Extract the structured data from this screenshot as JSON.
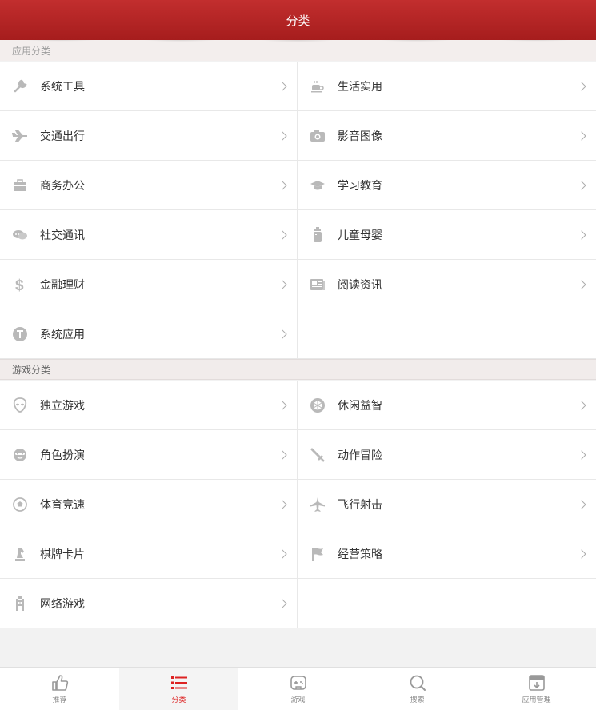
{
  "header": {
    "title": "分类"
  },
  "sections": {
    "apps_title": "应用分类",
    "games_title": "游戏分类"
  },
  "apps": [
    {
      "label": "系统工具",
      "icon": "wrench-icon"
    },
    {
      "label": "生活实用",
      "icon": "coffee-cup-icon"
    },
    {
      "label": "交通出行",
      "icon": "airplane-icon"
    },
    {
      "label": "影音图像",
      "icon": "camera-icon"
    },
    {
      "label": "商务办公",
      "icon": "briefcase-icon"
    },
    {
      "label": "学习教育",
      "icon": "graduation-cap-icon"
    },
    {
      "label": "社交通讯",
      "icon": "chat-bubbles-icon"
    },
    {
      "label": "儿童母婴",
      "icon": "baby-bottle-icon"
    },
    {
      "label": "金融理财",
      "icon": "dollar-icon"
    },
    {
      "label": "阅读资讯",
      "icon": "newspaper-icon"
    },
    {
      "label": "系统应用",
      "icon": "system-badge-icon"
    }
  ],
  "games": [
    {
      "label": "独立游戏",
      "icon": "alien-icon"
    },
    {
      "label": "休闲益智",
      "icon": "puzzle-cube-icon"
    },
    {
      "label": "角色扮演",
      "icon": "mask-icon"
    },
    {
      "label": "动作冒险",
      "icon": "sword-icon"
    },
    {
      "label": "体育竞速",
      "icon": "soccer-ball-icon"
    },
    {
      "label": "飞行射击",
      "icon": "fighter-jet-icon"
    },
    {
      "label": "棋牌卡片",
      "icon": "chess-knight-icon"
    },
    {
      "label": "经营策略",
      "icon": "flag-icon"
    },
    {
      "label": "网络游戏",
      "icon": "castle-tower-icon"
    }
  ],
  "tabbar": [
    {
      "label": "推荐",
      "icon": "thumbs-up-icon",
      "active": false
    },
    {
      "label": "分类",
      "icon": "list-icon",
      "active": true
    },
    {
      "label": "游戏",
      "icon": "gamepad-icon",
      "active": false
    },
    {
      "label": "搜索",
      "icon": "search-icon",
      "active": false
    },
    {
      "label": "应用管理",
      "icon": "app-manage-icon",
      "active": false
    }
  ],
  "colors": {
    "header_bg": "#b52525",
    "active_tab": "#dd2222",
    "icon_gray": "#b9b9b9"
  }
}
